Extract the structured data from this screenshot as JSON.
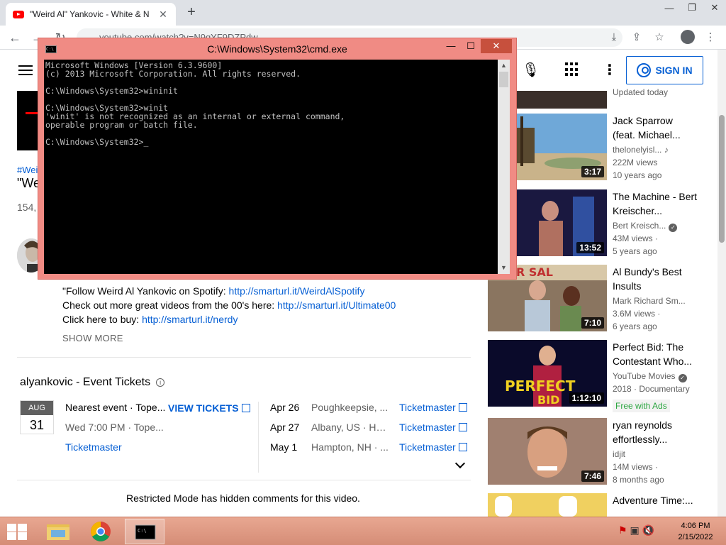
{
  "browser": {
    "tab_title": "\"Weird Al\" Yankovic - White & N",
    "tab_close": "✕",
    "new_tab": "+",
    "url": "youtube.com/watch?v=N9qYF9DZPdw",
    "window_min": "—",
    "window_max": "❐",
    "window_close": "✕"
  },
  "youtube": {
    "sign_in": "SIGN IN",
    "hashtag": "#Wei",
    "video_title": "\"We",
    "views": "154,",
    "description": {
      "line1_text": "\"Follow Weird Al Yankovic on Spotify: ",
      "line1_link": "http://smarturl.it/WeirdAlSpotify",
      "line2_text": "Check out more great videos from the 00's here: ",
      "line2_link": "http://smarturl.it/Ultimate00",
      "line3_text": "Click here to buy: ",
      "line3_link": "http://smarturl.it/nerdy"
    },
    "show_more": "SHOW MORE",
    "tickets": {
      "title": "alyankovic - Event Tickets",
      "month": "AUG",
      "day": "31",
      "nearest": "Nearest event · Tope...",
      "nearest_sub": "Wed 7:00 PM · Tope...",
      "nearest_link": "Ticketmaster",
      "view_tickets": "VIEW TICKETS",
      "events": [
        {
          "date": "Apr 26",
          "location": "Poughkeepsie, ...",
          "vendor": "Ticketmaster"
        },
        {
          "date": "Apr 27",
          "location": "Albany, US · Ha...",
          "vendor": "Ticketmaster"
        },
        {
          "date": "May 1",
          "location": "Hampton, NH · ...",
          "vendor": "Ticketmaster"
        }
      ]
    },
    "restricted": "Restricted Mode has hidden comments for this video.",
    "updated_today": "Updated today",
    "recommendations": [
      {
        "title": "Jack Sparrow (feat. Michael...",
        "channel": "thelonelyisl...",
        "views": "222M views",
        "age": "10 years ago",
        "duration": "3:17"
      },
      {
        "title": "The Machine - Bert Kreischer...",
        "channel": "Bert Kreisch...",
        "views": "43M views ·",
        "age": "5 years ago",
        "duration": "13:52"
      },
      {
        "title": "Al Bundy's Best Insults",
        "channel": "Mark Richard Sm...",
        "views": "3.6M views ·",
        "age": "6 years ago",
        "duration": "7:10"
      },
      {
        "title": "Perfect Bid: The Contestant Who...",
        "channel": "YouTube Movies",
        "views": "2018 · Documentary",
        "age": "",
        "duration": "1:12:10",
        "badge": "Free with Ads"
      },
      {
        "title": "ryan reynolds effortlessly...",
        "channel": "idjit",
        "views": "14M views ·",
        "age": "8 months ago",
        "duration": "7:46"
      },
      {
        "title": "Adventure Time:...",
        "channel": "",
        "views": "",
        "age": "",
        "duration": ""
      }
    ]
  },
  "cmd": {
    "title": "C:\\Windows\\System32\\cmd.exe",
    "btn_min": "—",
    "btn_max": "☐",
    "btn_close": "✕",
    "output": "Microsoft Windows [Version 6.3.9600]\n(c) 2013 Microsoft Corporation. All rights reserved.\n\nC:\\Windows\\System32>wininit\n\nC:\\Windows\\System32>winit\n'winit' is not recognized as an internal or external command,\noperable program or batch file.\n\nC:\\Windows\\System32>_"
  },
  "taskbar": {
    "time": "4:06 PM",
    "date": "2/15/2022"
  }
}
